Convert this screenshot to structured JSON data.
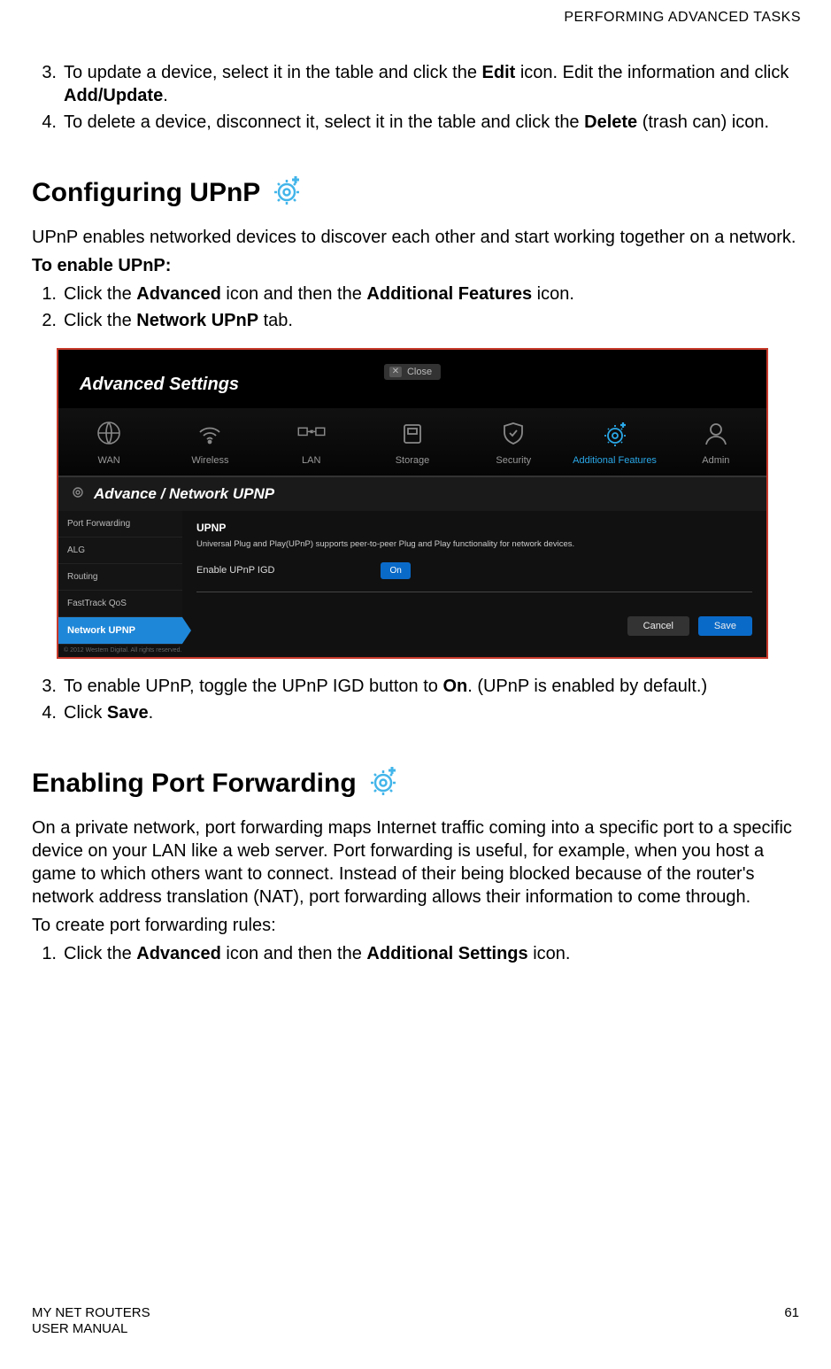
{
  "header": {
    "section": "PERFORMING ADVANCED TASKS"
  },
  "intro_steps": [
    {
      "n": "3.",
      "pre": "To update a device, select it in the table and click the ",
      "b1": "Edit",
      "mid": " icon. Edit the information and click ",
      "b2": "Add/Update",
      "post": "."
    },
    {
      "n": "4.",
      "pre": "To delete a device, disconnect it, select it in the table and click the ",
      "b1": "Delete",
      "mid": " (trash can) icon.",
      "b2": "",
      "post": ""
    }
  ],
  "upnp": {
    "heading": "Configuring UPnP",
    "intro": "UPnP enables networked devices to discover each other and start working together on a network.",
    "enable_label": "To enable UPnP:",
    "steps_a": [
      {
        "n": "1.",
        "pre": "Click the ",
        "b1": "Advanced",
        "mid": " icon and then the ",
        "b2": "Additional Features",
        "post": " icon."
      },
      {
        "n": "2.",
        "pre": "Click the ",
        "b1": "Network UPnP",
        "mid": " tab.",
        "b2": "",
        "post": ""
      }
    ],
    "steps_b": [
      {
        "n": "3.",
        "pre": "To enable UPnP, toggle the UPnP IGD button to ",
        "b1": "On",
        "mid": ". (UPnP is enabled by default.)",
        "b2": "",
        "post": ""
      },
      {
        "n": "4.",
        "pre": "Click ",
        "b1": "Save",
        "mid": ".",
        "b2": "",
        "post": ""
      }
    ]
  },
  "screenshot": {
    "close": "Close",
    "title": "Advanced Settings",
    "tabs": [
      "WAN",
      "Wireless",
      "LAN",
      "Storage",
      "Security",
      "Additional Features",
      "Admin"
    ],
    "active_tab": 5,
    "breadcrumb": "Advance / Network UPNP",
    "sidebar": [
      "Port Forwarding",
      "ALG",
      "Routing",
      "FastTrack QoS",
      "Network UPNP"
    ],
    "active_side": 4,
    "content_title": "UPNP",
    "content_desc": "Universal Plug and Play(UPnP) supports peer-to-peer Plug and Play functionality for network devices.",
    "toggle_label": "Enable UPnP IGD",
    "toggle_state": "On",
    "buttons": {
      "cancel": "Cancel",
      "save": "Save"
    },
    "copyright": "© 2012 Western Digital. All rights reserved."
  },
  "portfwd": {
    "heading": "Enabling Port Forwarding",
    "intro": "On a private network, port forwarding maps Internet traffic coming into a specific port to a specific device on your LAN like a web server. Port forwarding is useful, for example, when you host a game to which others want to connect. Instead of their being blocked because of the router's network address translation (NAT), port forwarding allows their information to come through.",
    "pre_steps": "To create port forwarding rules:",
    "steps": [
      {
        "n": "1.",
        "pre": "Click the ",
        "b1": "Advanced",
        "mid": " icon and then the ",
        "b2": "Additional Settings",
        "post": " icon."
      }
    ]
  },
  "footer": {
    "left1": "MY NET ROUTERS",
    "left2": "USER MANUAL",
    "page": "61"
  }
}
